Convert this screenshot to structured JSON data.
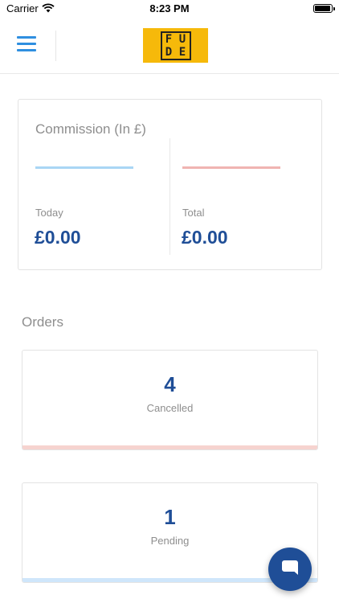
{
  "status_bar": {
    "carrier": "Carrier",
    "time": "8:23 PM",
    "wifi_icon": "wifi-icon",
    "battery_icon": "battery-icon"
  },
  "header": {
    "menu_icon": "hamburger-menu-icon",
    "logo": {
      "letters": [
        "F",
        "U",
        "D",
        "E"
      ],
      "background": "#f6b90a"
    }
  },
  "commission": {
    "title": "Commission (In £)",
    "today": {
      "label": "Today",
      "value": "£0.00",
      "accent": "#a9d6f5"
    },
    "total": {
      "label": "Total",
      "value": "£0.00",
      "accent": "#f0b4b2"
    }
  },
  "orders": {
    "title": "Orders",
    "items": [
      {
        "count": "4",
        "label": "Cancelled",
        "accent": "#f6d3cf"
      },
      {
        "count": "1",
        "label": "Pending",
        "accent": "#cfe6fb"
      }
    ]
  },
  "chat_button": {
    "icon": "chat-bubble-icon",
    "color": "#1f4e97"
  }
}
